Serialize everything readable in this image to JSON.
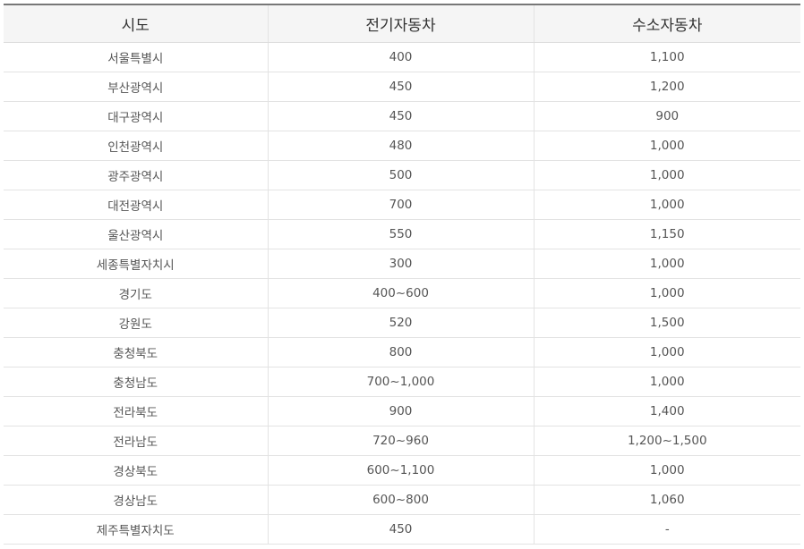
{
  "table": {
    "headers": [
      "시도",
      "전기자동차",
      "수소자동차"
    ],
    "rows": [
      [
        "서울특별시",
        "400",
        "1,100"
      ],
      [
        "부산광역시",
        "450",
        "1,200"
      ],
      [
        "대구광역시",
        "450",
        "900"
      ],
      [
        "인천광역시",
        "480",
        "1,000"
      ],
      [
        "광주광역시",
        "500",
        "1,000"
      ],
      [
        "대전광역시",
        "700",
        "1,000"
      ],
      [
        "울산광역시",
        "550",
        "1,150"
      ],
      [
        "세종특별자치시",
        "300",
        "1,000"
      ],
      [
        "경기도",
        "400~600",
        "1,000"
      ],
      [
        "강원도",
        "520",
        "1,500"
      ],
      [
        "충청북도",
        "800",
        "1,000"
      ],
      [
        "충청남도",
        "700~1,000",
        "1,000"
      ],
      [
        "전라북도",
        "900",
        "1,400"
      ],
      [
        "전라남도",
        "720~960",
        "1,200~1,500"
      ],
      [
        "경상북도",
        "600~1,100",
        "1,000"
      ],
      [
        "경상남도",
        "600~800",
        "1,060"
      ],
      [
        "제주특별자치도",
        "450",
        "-"
      ]
    ]
  },
  "colors": {
    "header_bg": "#f5f5f5",
    "header_top_border": "#777777",
    "grid_line": "#e3e3e3",
    "text": "#555555"
  }
}
